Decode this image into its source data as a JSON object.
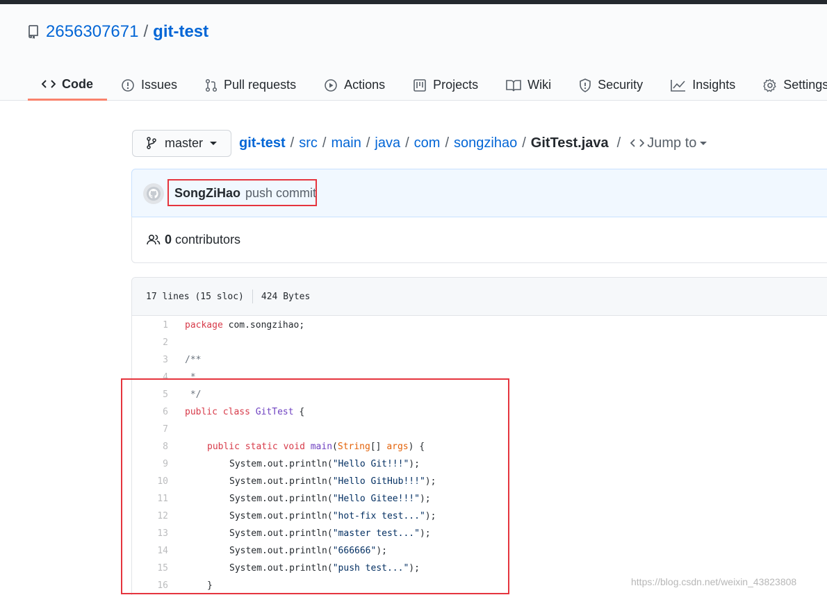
{
  "repo": {
    "owner": "2656307671",
    "separator": "/",
    "name": "git-test"
  },
  "tabs": [
    {
      "label": "Code",
      "icon": "code-icon",
      "active": true
    },
    {
      "label": "Issues",
      "icon": "issue-icon"
    },
    {
      "label": "Pull requests",
      "icon": "pull-request-icon"
    },
    {
      "label": "Actions",
      "icon": "play-icon"
    },
    {
      "label": "Projects",
      "icon": "project-icon"
    },
    {
      "label": "Wiki",
      "icon": "book-icon"
    },
    {
      "label": "Security",
      "icon": "shield-icon"
    },
    {
      "label": "Insights",
      "icon": "graph-icon"
    },
    {
      "label": "Settings",
      "icon": "gear-icon"
    }
  ],
  "breadcrumb": {
    "branch": "master",
    "path": [
      "git-test",
      "src",
      "main",
      "java",
      "com",
      "songzihao"
    ],
    "file": "GitTest.java",
    "jump_label": "Jump to"
  },
  "commit": {
    "author": "SongZiHao",
    "message": "push commit"
  },
  "contributors": {
    "count": "0",
    "label": "contributors"
  },
  "file_info": {
    "lines": "17 lines (15 sloc)",
    "size": "424 Bytes"
  },
  "code_lines": [
    {
      "n": "1"
    },
    {
      "n": "2"
    },
    {
      "n": "3"
    },
    {
      "n": "4"
    },
    {
      "n": "5"
    },
    {
      "n": "6"
    },
    {
      "n": "7"
    },
    {
      "n": "8"
    },
    {
      "n": "9"
    },
    {
      "n": "10"
    },
    {
      "n": "11"
    },
    {
      "n": "12"
    },
    {
      "n": "13"
    },
    {
      "n": "14"
    },
    {
      "n": "15"
    },
    {
      "n": "16"
    }
  ],
  "code": {
    "l1": {
      "kw": "package",
      "rest": " com.songzihao;"
    },
    "l3": "/**",
    "l4": " *",
    "l5": " */",
    "l6": {
      "kw1": "public",
      "kw2": "class",
      "name": "GitTest",
      "rest": " {"
    },
    "l8": {
      "kw1": "public",
      "kw2": "static",
      "kw3": "void",
      "name": "main",
      "open": "(",
      "type": "String",
      "brackets": "[] ",
      "arg": "args",
      "close": ") {"
    },
    "prints": [
      {
        "pre": "System.out.println(",
        "str": "\"Hello Git!!!\"",
        "post": ");"
      },
      {
        "pre": "System.out.println(",
        "str": "\"Hello GitHub!!!\"",
        "post": ");"
      },
      {
        "pre": "System.out.println(",
        "str": "\"Hello Gitee!!!\"",
        "post": ");"
      },
      {
        "pre": "System.out.println(",
        "str": "\"hot-fix test...\"",
        "post": ");"
      },
      {
        "pre": "System.out.println(",
        "str": "\"master test...\"",
        "post": ");"
      },
      {
        "pre": "System.out.println(",
        "str": "\"666666\"",
        "post": ");"
      },
      {
        "pre": "System.out.println(",
        "str": "\"push test...\"",
        "post": ");"
      }
    ],
    "l16": "}"
  },
  "watermark": "https://blog.csdn.net/weixin_43823808",
  "colors": {
    "link": "#0366d6",
    "active_tab_border": "#f9826c",
    "highlight_box": "#e5343d"
  }
}
